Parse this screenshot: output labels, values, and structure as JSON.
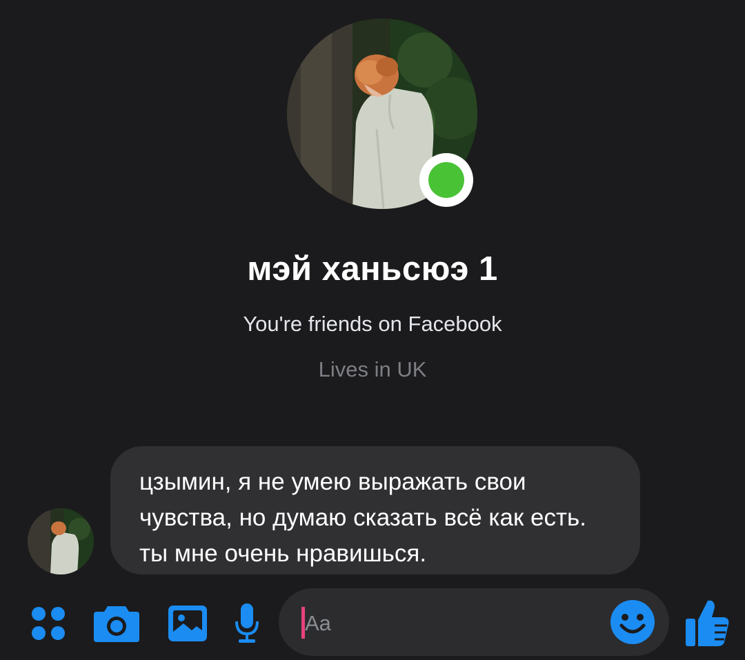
{
  "conversation": {
    "contact_name": "мэй ханьсюэ 1",
    "friendship_status": "You're friends on Facebook",
    "location": "Lives in UK",
    "online": true
  },
  "messages": [
    {
      "from": "contact",
      "text": "цзымин, я не умею выражать свои чувства, но думаю сказать всё как есть. ты мне очень нравишься."
    }
  ],
  "composer": {
    "placeholder": "Aa",
    "actions": [
      "apps-icon",
      "camera-icon",
      "gallery-icon",
      "microphone-icon",
      "emoji-icon",
      "thumbs-up-icon"
    ]
  },
  "colors": {
    "background": "#1b1b1d",
    "bubble": "#303033",
    "accent": "#1b8cf2",
    "online": "#4ac236",
    "caret": "#e8427e"
  }
}
